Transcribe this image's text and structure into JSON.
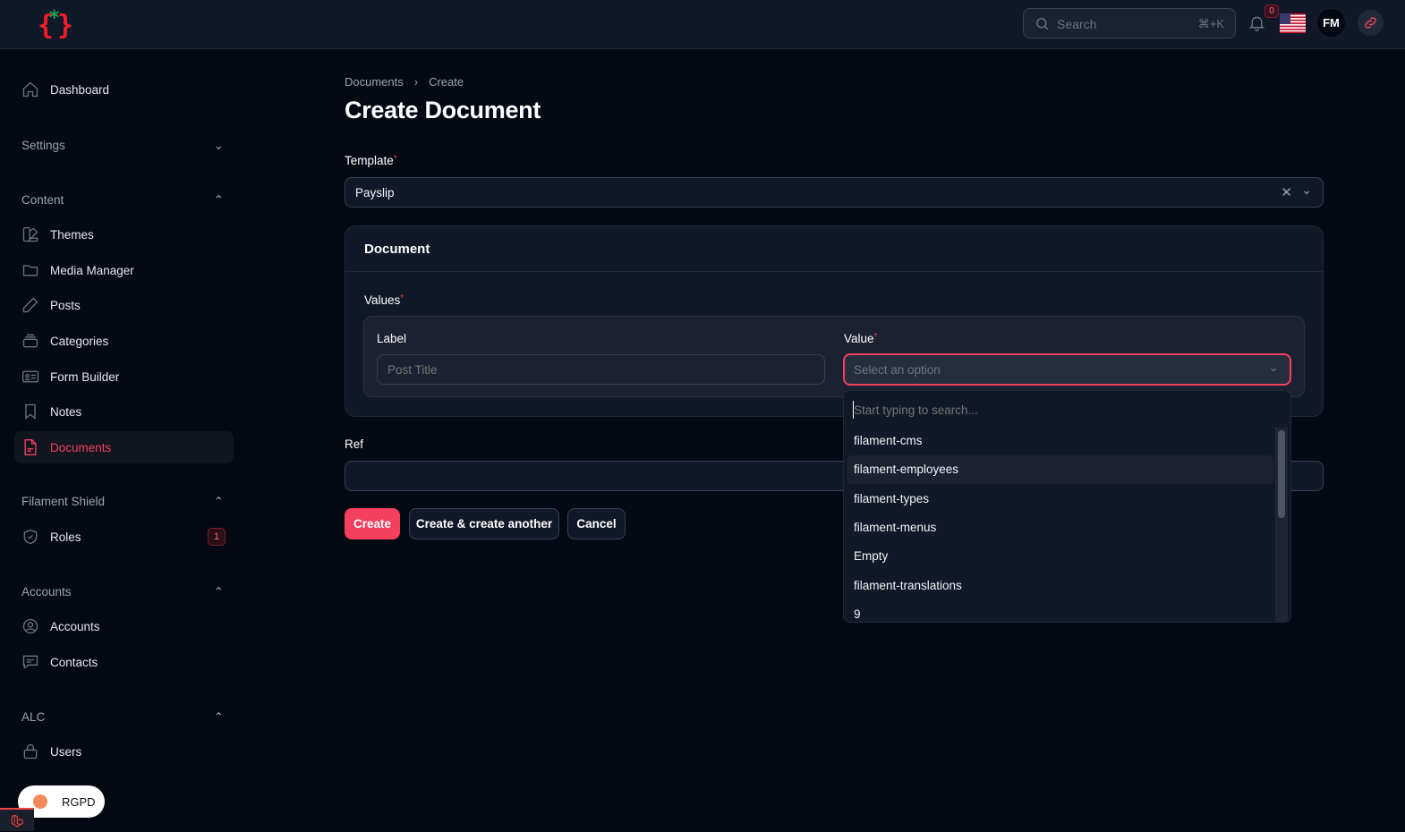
{
  "topbar": {
    "search_placeholder": "Search",
    "search_shortcut": "⌘+K",
    "notification_count": "0",
    "avatar_initials": "FM"
  },
  "sidebar": {
    "dashboard": "Dashboard",
    "groups": {
      "settings": "Settings",
      "content": "Content",
      "shield": "Filament Shield",
      "accounts": "Accounts",
      "alc": "ALC"
    },
    "items": {
      "themes": "Themes",
      "media": "Media Manager",
      "posts": "Posts",
      "categories": "Categories",
      "form_builder": "Form Builder",
      "notes": "Notes",
      "documents": "Documents",
      "roles": "Roles",
      "roles_badge": "1",
      "accounts": "Accounts",
      "contacts": "Contacts",
      "users": "Users"
    }
  },
  "breadcrumb": [
    "Documents",
    "Create"
  ],
  "page_title": "Create Document",
  "form": {
    "template_label": "Template",
    "template_value": "Payslip",
    "section_title": "Document",
    "values_label": "Values",
    "label_label": "Label",
    "label_placeholder": "Post Title",
    "value_label": "Value",
    "value_placeholder": "Select an option",
    "ref_label": "Ref",
    "ref_value": ""
  },
  "dropdown": {
    "search_placeholder": "Start typing to search...",
    "options": [
      "filament-cms",
      "filament-employees",
      "filament-types",
      "filament-menus",
      "Empty",
      "filament-translations",
      "9"
    ],
    "highlighted": "filament-employees"
  },
  "actions": {
    "create": "Create",
    "create_another": "Create & create another",
    "cancel": "Cancel"
  },
  "cookie": {
    "label": "RGPD"
  },
  "colors": {
    "primary": "#f43f5e",
    "background": "#050914",
    "surface": "#111827"
  }
}
